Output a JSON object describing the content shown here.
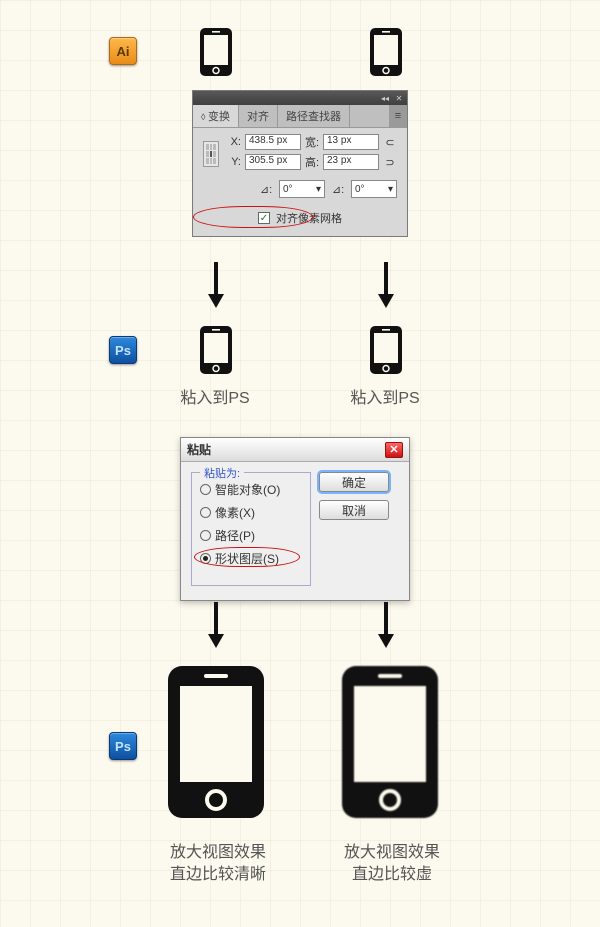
{
  "icons": {
    "ai_label": "Ai",
    "ps_label": "Ps"
  },
  "captions": {
    "paste_left": "粘入到PS",
    "paste_right": "粘入到PS",
    "result_left_l1": "放大视图效果",
    "result_left_l2": "直边比较清晰",
    "result_right_l1": "放大视图效果",
    "result_right_l2": "直边比较虚"
  },
  "ai_panel": {
    "tabs": {
      "transform": "变换",
      "align": "对齐",
      "pathfinder": "路径查找器"
    },
    "x_label": "X:",
    "y_label": "Y:",
    "w_label": "宽:",
    "h_label": "高:",
    "x_val": "438.5 px",
    "y_val": "305.5 px",
    "w_val": "13 px",
    "h_val": "23 px",
    "angle_sym": "⊿:",
    "shear_sym": "⊿:",
    "angle_val": "0°",
    "shear_val": "0°",
    "align_pixel_label": "对齐像素网格"
  },
  "ps_dialog": {
    "title": "粘贴",
    "legend": "粘贴为:",
    "options": {
      "smart_object": "智能对象(O)",
      "pixels": "像素(X)",
      "path": "路径(P)",
      "shape_layer": "形状图层(S)"
    },
    "ok": "确定",
    "cancel": "取消"
  }
}
